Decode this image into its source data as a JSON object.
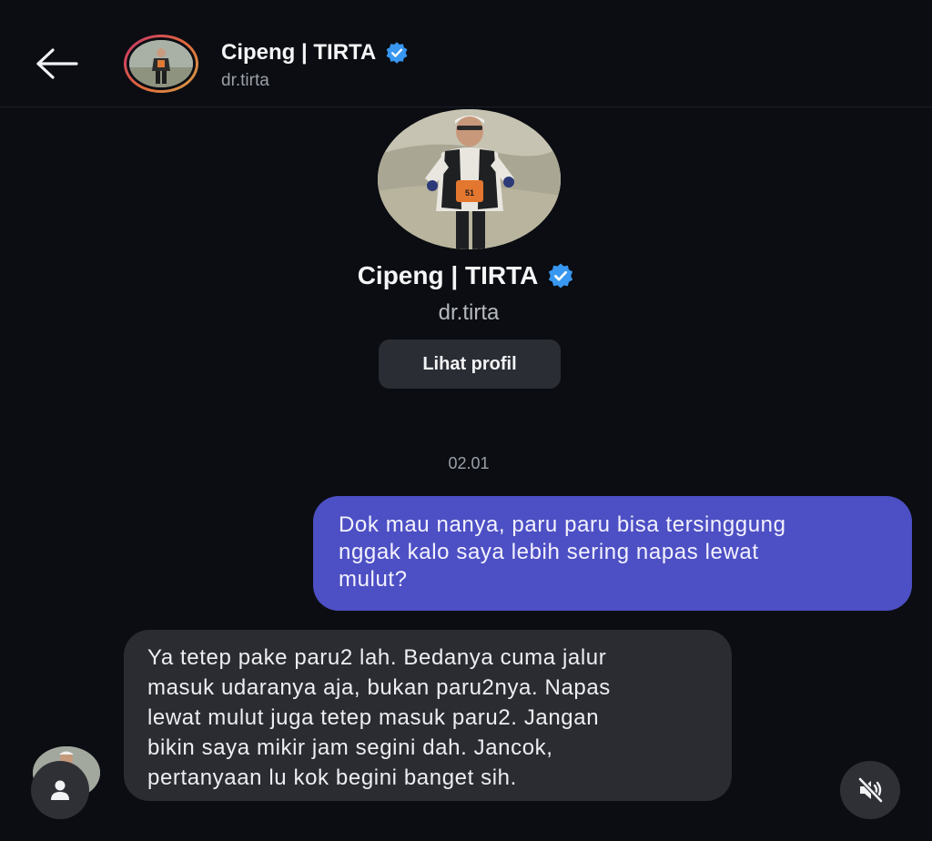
{
  "header": {
    "display_name": "Cipeng | TIRTA",
    "username": "dr.tirta",
    "back_icon": "arrow-left-icon",
    "verified_icon": "verified-badge-icon",
    "story_ring_colors": [
      "#c7336b",
      "#e06b3b",
      "#d4a04a"
    ]
  },
  "profile": {
    "display_name": "Cipeng | TIRTA",
    "username": "dr.tirta",
    "view_profile_label": "Lihat profil",
    "photo_bib_number": "51"
  },
  "conversation": {
    "timestamp": "02.01",
    "messages": [
      {
        "direction": "outgoing",
        "lines": [
          "Dok mau nanya, paru paru bisa tersinggung",
          "nggak kalo saya lebih sering napas lewat",
          "mulut?"
        ]
      },
      {
        "direction": "incoming",
        "lines": [
          "Ya tetep pake paru2 lah. Bedanya cuma jalur",
          "masuk udaranya aja, bukan paru2nya. Napas",
          "lewat mulut juga tetep masuk paru2. Jangan",
          "bikin saya mikir jam segini dah. Jancok,",
          "pertanyaan lu kok begini banget sih."
        ]
      }
    ]
  },
  "controls": {
    "user_icon": "user-icon",
    "mute_icon": "speaker-muted-icon"
  },
  "colors": {
    "background": "#0b0d12",
    "outgoing_bubble": "#4d4fc4",
    "incoming_bubble": "#2a2c31",
    "verified_blue": "#3897f0"
  }
}
